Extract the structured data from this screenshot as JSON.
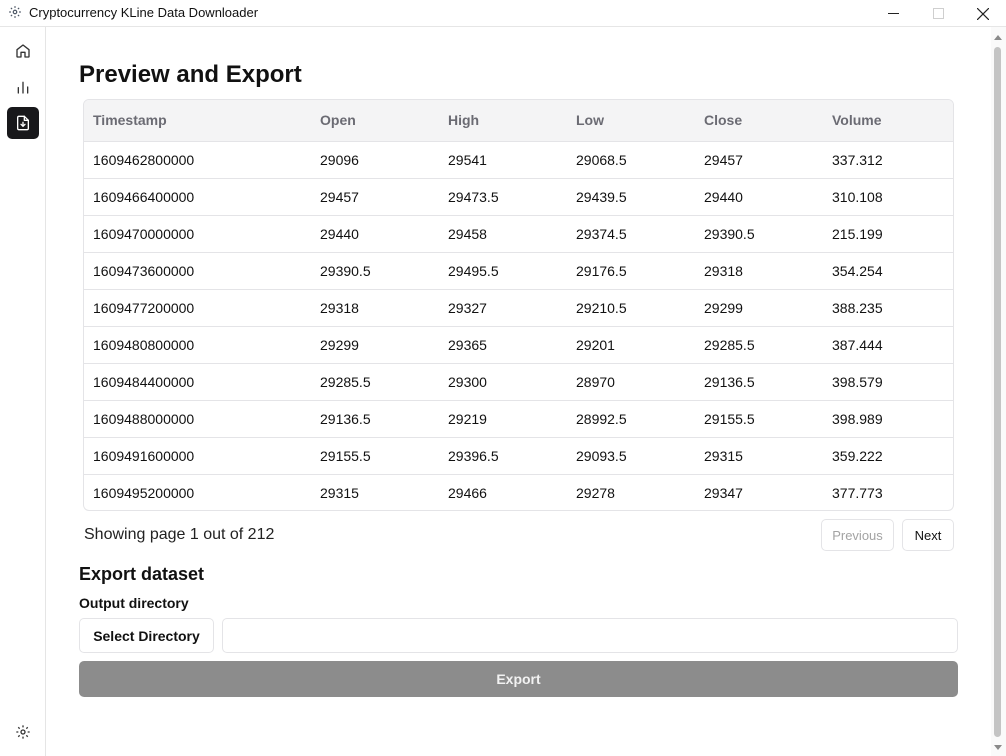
{
  "window": {
    "title": "Cryptocurrency KLine Data Downloader"
  },
  "icons": {
    "app": "gear-icon",
    "minimize": "minimize-icon",
    "maximize": "maximize-icon",
    "close": "close-icon",
    "home": "home-icon",
    "chart": "bar-chart-icon",
    "export": "file-download-icon",
    "settings": "gear-icon"
  },
  "page": {
    "title": "Preview and Export"
  },
  "table": {
    "columns": [
      "Timestamp",
      "Open",
      "High",
      "Low",
      "Close",
      "Volume"
    ],
    "rows": [
      [
        "1609462800000",
        "29096",
        "29541",
        "29068.5",
        "29457",
        "337.312"
      ],
      [
        "1609466400000",
        "29457",
        "29473.5",
        "29439.5",
        "29440",
        "310.108"
      ],
      [
        "1609470000000",
        "29440",
        "29458",
        "29374.5",
        "29390.5",
        "215.199"
      ],
      [
        "1609473600000",
        "29390.5",
        "29495.5",
        "29176.5",
        "29318",
        "354.254"
      ],
      [
        "1609477200000",
        "29318",
        "29327",
        "29210.5",
        "29299",
        "388.235"
      ],
      [
        "1609480800000",
        "29299",
        "29365",
        "29201",
        "29285.5",
        "387.444"
      ],
      [
        "1609484400000",
        "29285.5",
        "29300",
        "28970",
        "29136.5",
        "398.579"
      ],
      [
        "1609488000000",
        "29136.5",
        "29219",
        "28992.5",
        "29155.5",
        "398.989"
      ],
      [
        "1609491600000",
        "29155.5",
        "29396.5",
        "29093.5",
        "29315",
        "359.222"
      ],
      [
        "1609495200000",
        "29315",
        "29466",
        "29278",
        "29347",
        "377.773"
      ]
    ]
  },
  "pagination": {
    "status": "Showing page 1 out of 212",
    "prev_label": "Previous",
    "next_label": "Next"
  },
  "export": {
    "title": "Export dataset",
    "output_label": "Output directory",
    "select_label": "Select Directory",
    "directory_value": "",
    "export_label": "Export"
  }
}
